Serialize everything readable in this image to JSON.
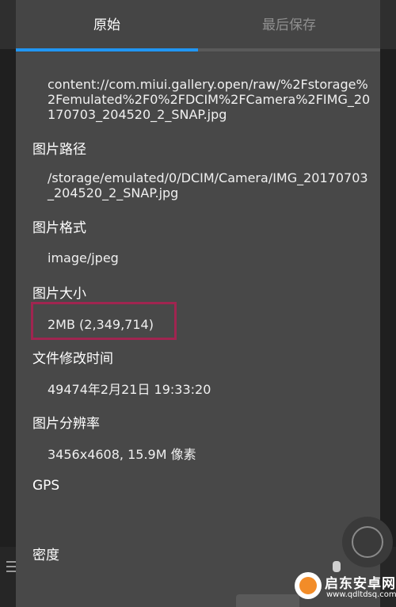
{
  "tabs": {
    "original": "原始",
    "last_saved": "最后保存"
  },
  "details": {
    "uri": "content://com.miui.gallery.open/raw/%2Fstorage%2Femulated%2F0%2FDCIM%2FCamera%2FIMG_20170703_204520_2_SNAP.jpg",
    "path_label": "图片路径",
    "path_value": "/storage/emulated/0/DCIM/Camera/IMG_20170703_204520_2_SNAP.jpg",
    "format_label": "图片格式",
    "format_value": "image/jpeg",
    "size_label": "图片大小",
    "size_value": "2MB (2,349,714)",
    "modified_label": "文件修改时间",
    "modified_value": "49474年2月21日 19:33:20",
    "resolution_label": "图片分辨率",
    "resolution_value": "3456x4608, 15.9M 像素",
    "gps_label": "GPS",
    "density_label": "密度"
  },
  "watermark": {
    "title": "启东安卓网",
    "url": "www.qdltdsq.com"
  },
  "colors": {
    "accent": "#2196f3",
    "highlight": "#a02550",
    "dialog_bg": "#484848"
  }
}
